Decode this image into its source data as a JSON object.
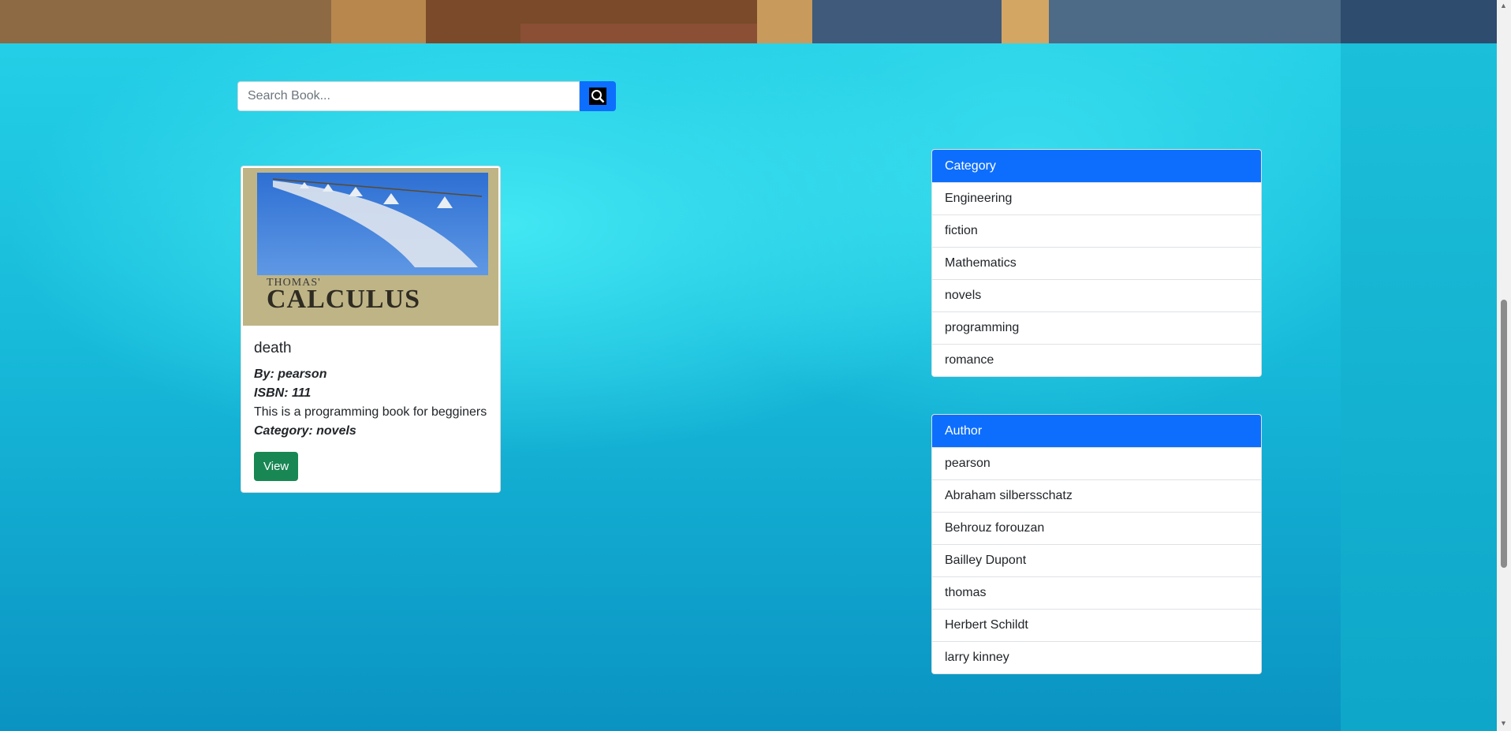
{
  "search": {
    "placeholder": "Search Book...",
    "icon": "search-icon"
  },
  "book": {
    "cover_title_small": "THOMAS'",
    "cover_title_large": "CALCULUS",
    "title": "death",
    "by": "By: pearson",
    "isbn": "ISBN: 111",
    "description": "This is a programming book for begginers",
    "category": "Category: novels",
    "view_label": "View"
  },
  "category_panel": {
    "heading": "Category",
    "items": [
      "Engineering",
      "fiction",
      "Mathematics",
      "novels",
      "programming",
      "romance"
    ]
  },
  "author_panel": {
    "heading": "Author",
    "items": [
      "pearson",
      "Abraham silbersschatz",
      "Behrouz forouzan",
      "Bailley Dupont",
      "thomas",
      "Herbert Schildt",
      "larry kinney"
    ]
  },
  "colors": {
    "primary": "#0d6efd",
    "success": "#198754",
    "background": "#17b9d9"
  }
}
